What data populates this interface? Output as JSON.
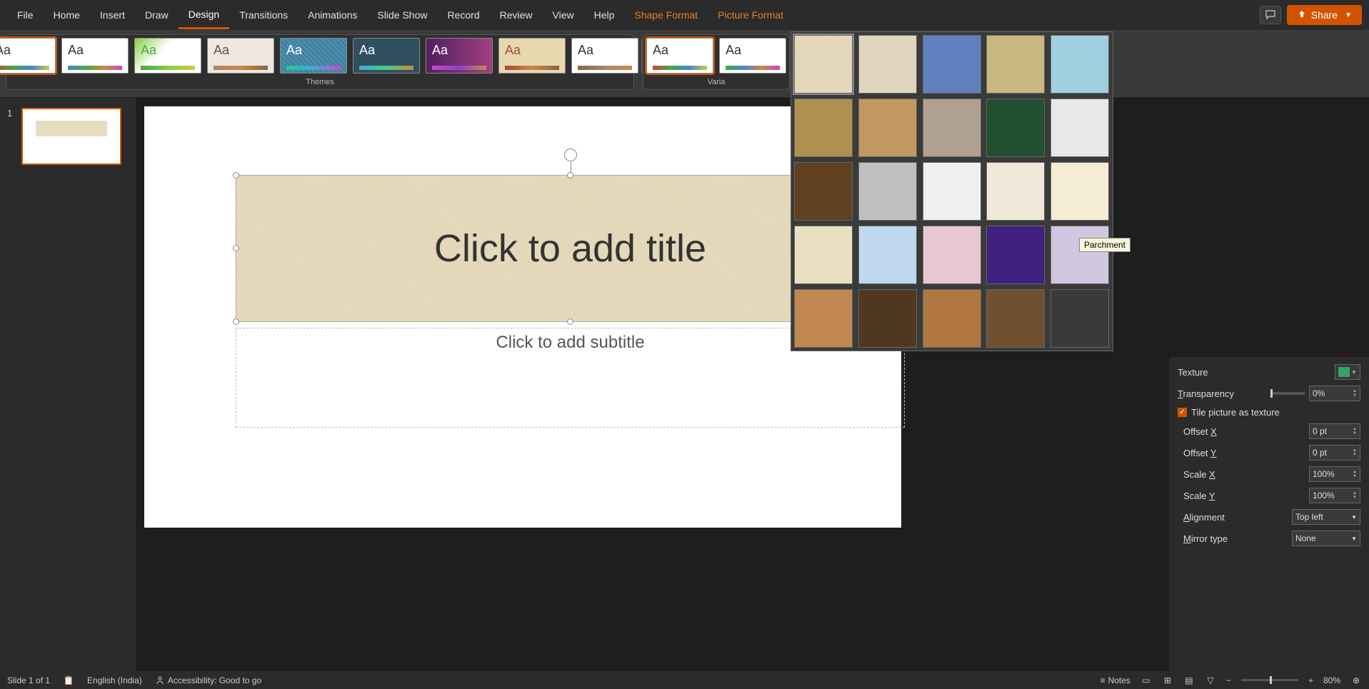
{
  "tabs": {
    "file": "File",
    "home": "Home",
    "insert": "Insert",
    "draw": "Draw",
    "design": "Design",
    "transitions": "Transitions",
    "animations": "Animations",
    "slideshow": "Slide Show",
    "record": "Record",
    "review": "Review",
    "view": "View",
    "help": "Help",
    "shapeformat": "Shape Format",
    "pictureformat": "Picture Format"
  },
  "share_label": "Share",
  "ribbon": {
    "themes_label": "Themes",
    "variants_label": "Varia"
  },
  "slide": {
    "number": "1",
    "title_placeholder": "Click to add title",
    "subtitle_placeholder": "Click to add subtitle"
  },
  "tooltip": "Parchment",
  "format_pane": {
    "texture_label": "Texture",
    "transparency_label": "Transparency",
    "transparency_value": "0%",
    "tile_label": "Tile picture as texture",
    "offsetx_label": "Offset X",
    "offsetx_value": "0 pt",
    "offsety_label": "Offset Y",
    "offsety_value": "0 pt",
    "scalex_label": "Scale X",
    "scalex_value": "100%",
    "scaley_label": "Scale Y",
    "scaley_value": "100%",
    "alignment_label": "Alignment",
    "alignment_value": "Top left",
    "mirror_label": "Mirror type",
    "mirror_value": "None"
  },
  "statusbar": {
    "slide_info": "Slide 1 of 1",
    "language": "English (India)",
    "accessibility": "Accessibility: Good to go",
    "notes_label": "Notes",
    "zoom": "80%"
  },
  "textures": {
    "colors": [
      "#e8dcc0",
      "#e0d5c0",
      "#6080c0",
      "#c8b880",
      "#a0d0e0",
      "#b09050",
      "#c09860",
      "#b0a090",
      "#205030",
      "#e8e8e8",
      "#604020",
      "#c0c0c0",
      "#f0f0f0",
      "#f0e8d8",
      "#f5ecd5",
      "#e8e0c0",
      "#c0d8f0",
      "#e8c8d0",
      "#402080",
      "#d0c8e0",
      "#c08850",
      "#503820",
      "#b07840",
      "#705030",
      "#3a3a3a"
    ]
  },
  "theme_styles": [
    {
      "bg": "#fff",
      "aa": "#333",
      "bar": "linear-gradient(90deg,#c44,#4a4,#48c,#cc4)"
    },
    {
      "bg": "#fff",
      "aa": "#333",
      "bar": "linear-gradient(90deg,#48c,#4a4,#c84,#c4c)"
    },
    {
      "bg": "linear-gradient(135deg,#8c4,#fff 40%)",
      "aa": "#4a4",
      "bar": "linear-gradient(90deg,#4a4,#8c4,#cc4)"
    },
    {
      "bg": "#f0e8e0",
      "aa": "#555",
      "bar": "linear-gradient(90deg,#a86,#c84,#864)"
    },
    {
      "bg": "repeating-linear-gradient(45deg,#4080a0,#4080a0 3px,#5090b0 3px,#5090b0 5px)",
      "aa": "#fff",
      "bar": "linear-gradient(90deg,#2c8,#4ac,#c4c)"
    },
    {
      "bg": "#305060",
      "aa": "#fff",
      "bar": "linear-gradient(90deg,#4ac,#4c8,#c84)"
    },
    {
      "bg": "linear-gradient(90deg,#502060,#a04080)",
      "aa": "#fff",
      "bar": "linear-gradient(90deg,#c4c,#84c,#c84)"
    },
    {
      "bg": "#e8d8b0",
      "aa": "#a44",
      "bar": "linear-gradient(90deg,#a44,#c84,#864)"
    },
    {
      "bg": "#fff",
      "aa": "#333",
      "bar": "linear-gradient(90deg,#864,#a86,#c84)"
    }
  ]
}
